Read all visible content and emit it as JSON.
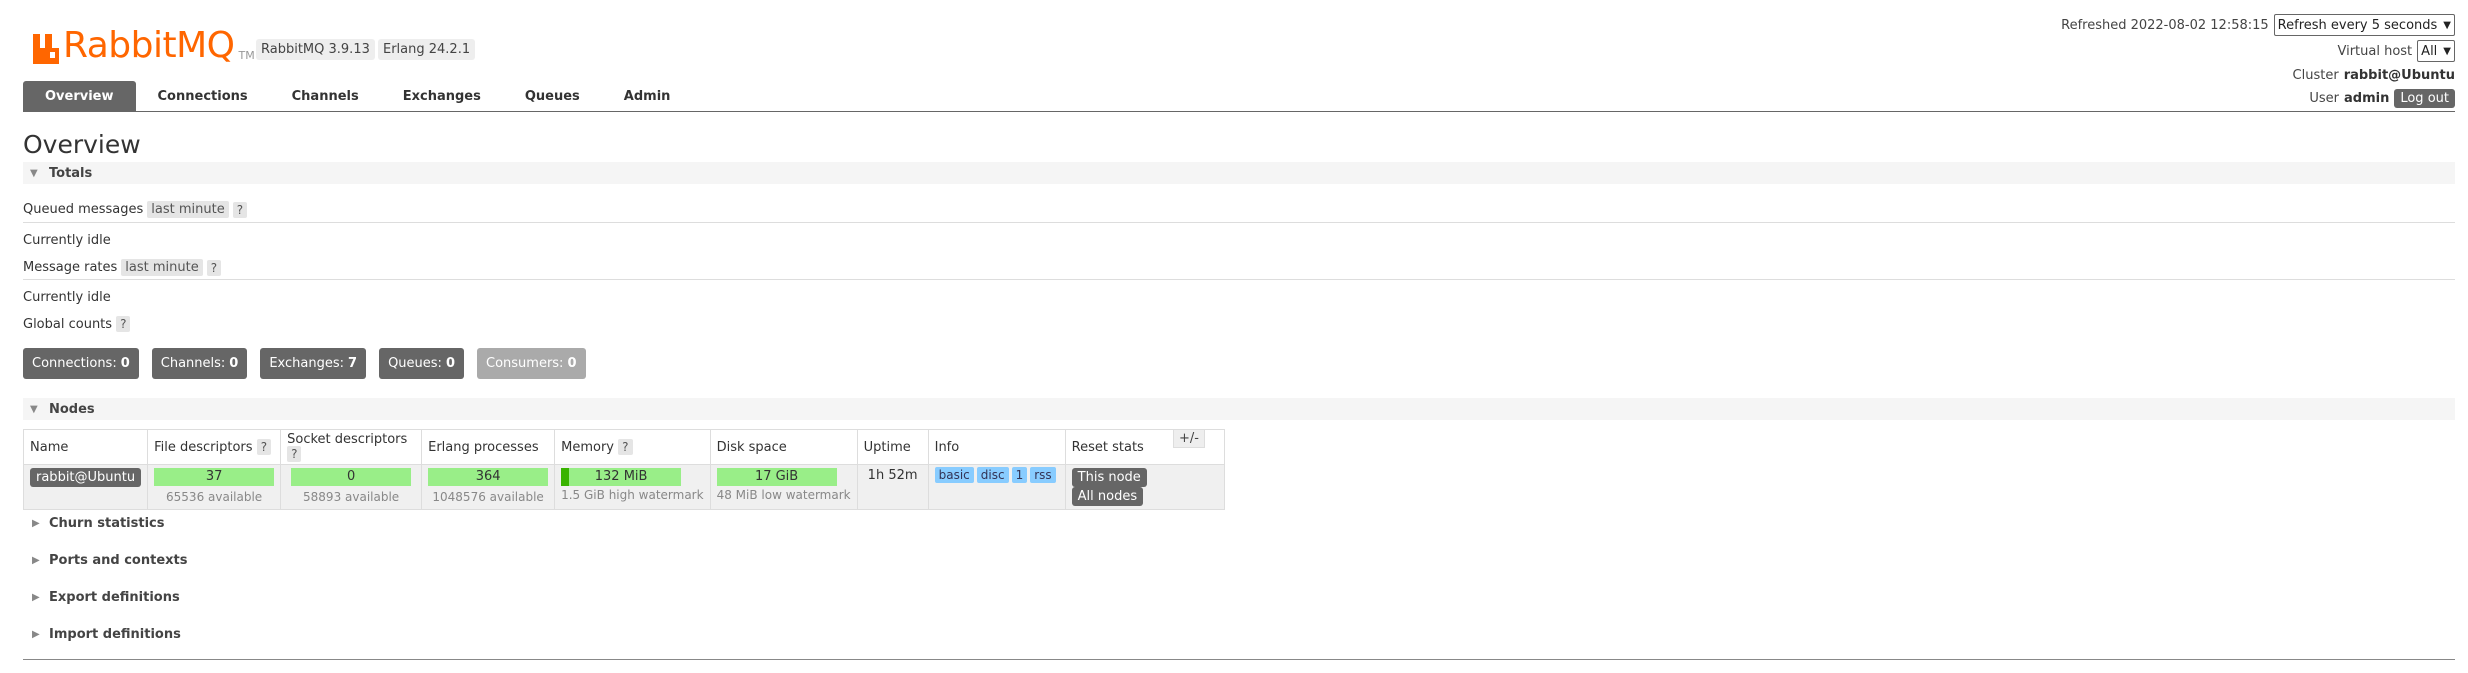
{
  "brand": {
    "name_rabbit": "Rabbit",
    "name_mq": "MQ",
    "tm": "TM"
  },
  "versions": {
    "rabbitmq": "RabbitMQ 3.9.13",
    "erlang": "Erlang 24.2.1"
  },
  "header": {
    "refreshed_label": "Refreshed 2022-08-02 12:58:15",
    "refresh_select": "Refresh every 5 seconds",
    "vhost_label": "Virtual host",
    "vhost_select": "All",
    "cluster_label": "Cluster",
    "cluster_value": "rabbit@Ubuntu",
    "user_label": "User",
    "user_value": "admin",
    "logout": "Log out"
  },
  "tabs": [
    "Overview",
    "Connections",
    "Channels",
    "Exchanges",
    "Queues",
    "Admin"
  ],
  "page_title": "Overview",
  "totals": {
    "heading": "Totals",
    "queued_label": "Queued messages",
    "queued_range": "last minute",
    "help": "?",
    "queued_state": "Currently idle",
    "rates_label": "Message rates",
    "rates_range": "last minute",
    "rates_state": "Currently idle",
    "global_label": "Global counts",
    "counts": [
      {
        "label": "Connections:",
        "value": "0"
      },
      {
        "label": "Channels:",
        "value": "0"
      },
      {
        "label": "Exchanges:",
        "value": "7"
      },
      {
        "label": "Queues:",
        "value": "0"
      },
      {
        "label": "Consumers:",
        "value": "0"
      }
    ]
  },
  "nodes": {
    "heading": "Nodes",
    "columns": {
      "name": "Name",
      "fd": "File descriptors",
      "sock": "Socket descriptors",
      "erl": "Erlang processes",
      "mem": "Memory",
      "disk": "Disk space",
      "uptime": "Uptime",
      "info": "Info",
      "reset": "Reset stats"
    },
    "toggle": "+/-",
    "row": {
      "name": "rabbit@Ubuntu",
      "fd_used": "37",
      "fd_avail": "65536 available",
      "sock_used": "0",
      "sock_avail": "58893 available",
      "erl_used": "364",
      "erl_avail": "1048576 available",
      "mem_used": "132 MiB",
      "mem_watermark": "1.5 GiB high watermark",
      "disk_free": "17 GiB",
      "disk_watermark": "48 MiB low watermark",
      "uptime": "1h 52m",
      "info_tags": [
        "basic",
        "disc",
        "1",
        "rss"
      ],
      "reset_this": "This node",
      "reset_all": "All nodes"
    }
  },
  "collapsed_sections": [
    "Churn statistics",
    "Ports and contexts",
    "Export definitions",
    "Import definitions"
  ]
}
